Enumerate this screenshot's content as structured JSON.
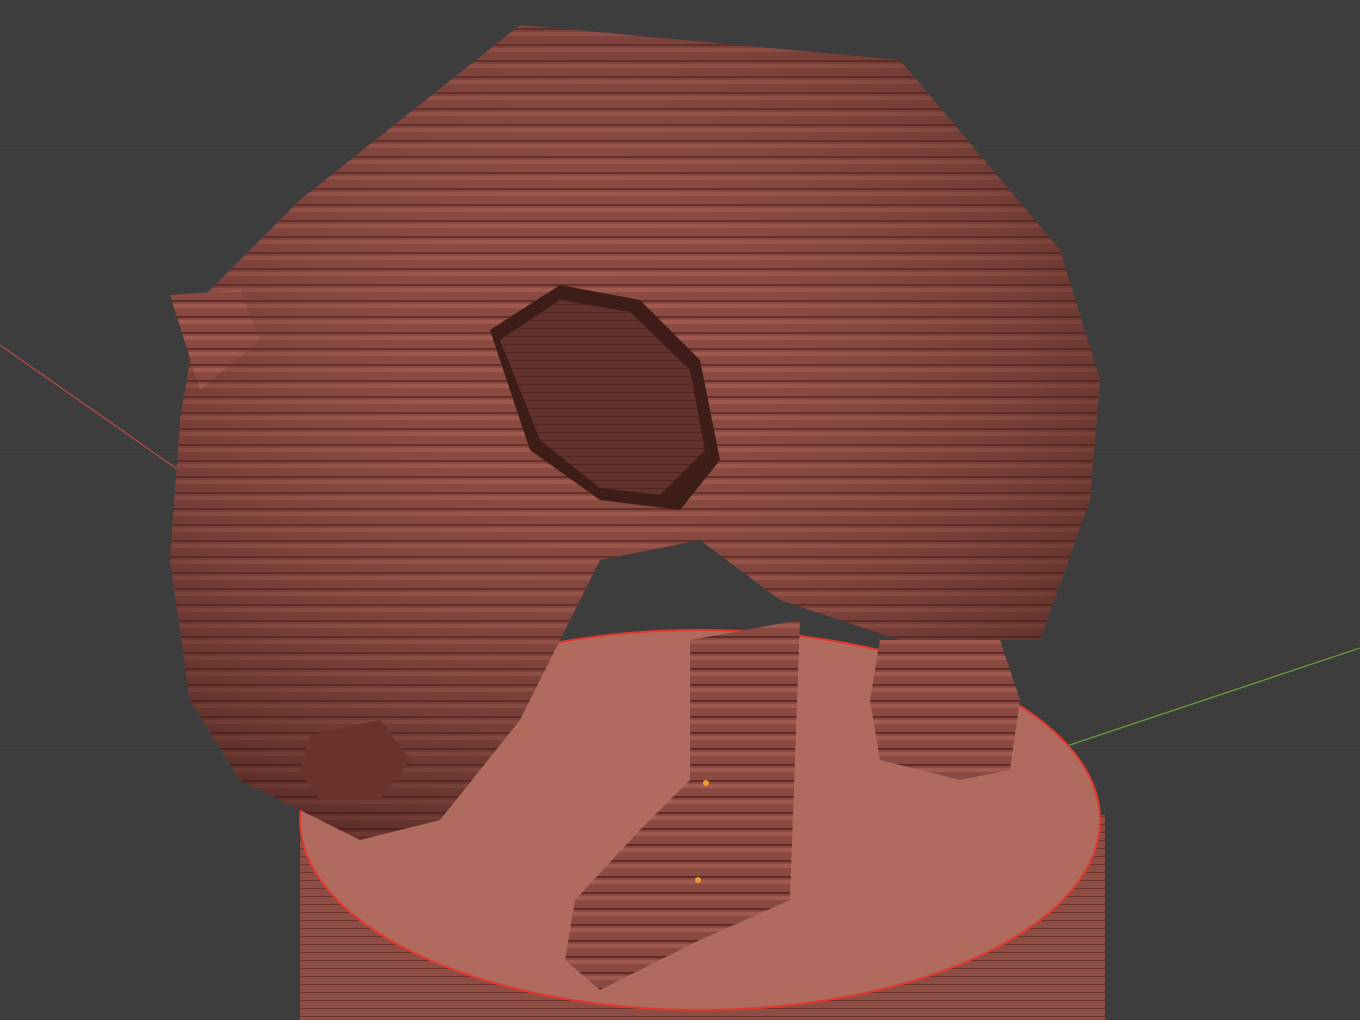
{
  "viewport": {
    "background": "#3d3d3d",
    "grid_color": "#353535",
    "x_axis_color": "#b34a4a",
    "y_axis_color": "#6a9a3a"
  },
  "model": {
    "kind": "stacked-slice bear sculpture on round pedestal",
    "body_color": "#8a4a42",
    "shadow_color": "#5a2a24",
    "highlight_color": "#b0675c",
    "pedestal_color": "#b06a5e",
    "selection_outline_color": "#e0392e"
  },
  "gizmo": {
    "origin_marker_color": "#f29a2e"
  }
}
